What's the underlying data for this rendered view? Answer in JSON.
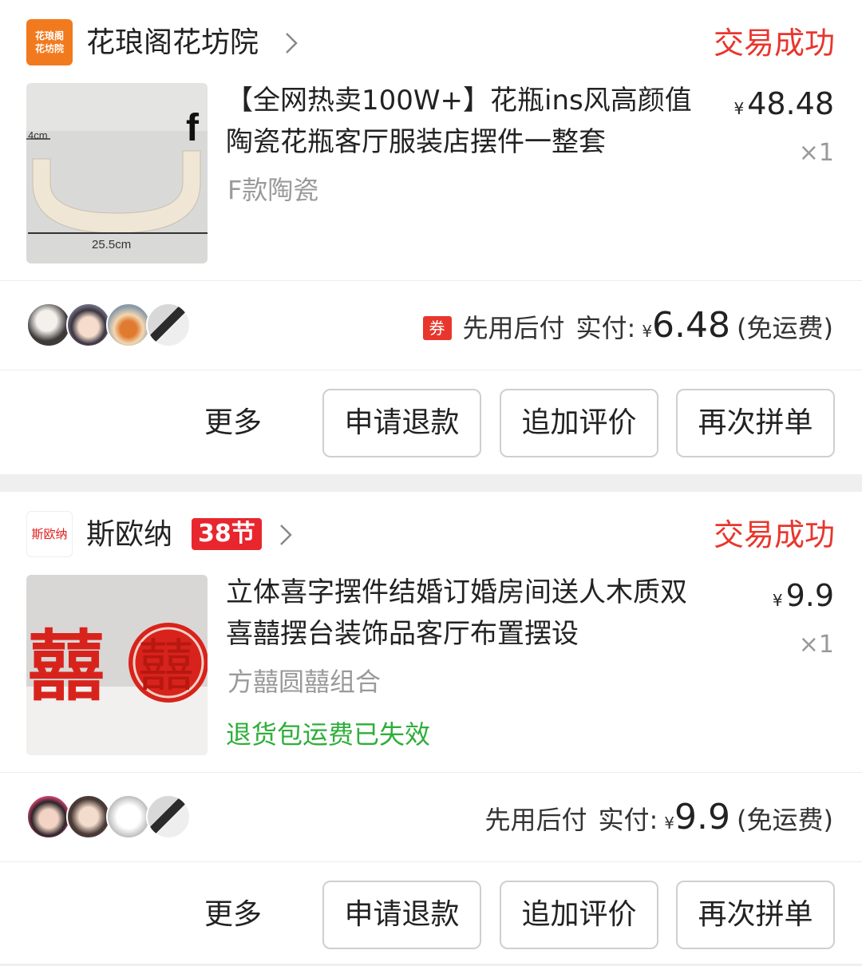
{
  "orders": [
    {
      "shop": {
        "logo_text": [
          "花琅阁",
          "花坊院"
        ],
        "name": "花琅阁花坊院",
        "status": "交易成功"
      },
      "product": {
        "title": "【全网热卖100W+】花瓶ins风高颜值陶瓷花瓶客厅服装店摆件一整套",
        "sku": "F款陶瓷",
        "price_symbol": "¥",
        "price": "48.48",
        "qty": "×1",
        "image_labels": {
          "height": "4cm",
          "width": "25.5cm",
          "corner": "f"
        }
      },
      "payment": {
        "coupon_icon": "券",
        "method": "先用后付",
        "paid_label": "实付:",
        "paid_symbol": "¥",
        "paid_amount": "6.48",
        "shipping": "(免运费)"
      },
      "actions": {
        "more": "更多",
        "refund": "申请退款",
        "review": "追加评价",
        "reorder": "再次拼单"
      }
    },
    {
      "shop": {
        "logo_text": [
          "斯欧纳"
        ],
        "name": "斯欧纳",
        "badge": "38节",
        "status": "交易成功"
      },
      "product": {
        "title": "立体喜字摆件结婚订婚房间送人木质双喜囍摆台装饰品客厅布置摆设",
        "sku": "方囍圆囍组合",
        "return_note": "退货包运费已失效",
        "price_symbol": "¥",
        "price": "9.9",
        "qty": "×1",
        "image_glyph": "囍"
      },
      "payment": {
        "method": "先用后付",
        "paid_label": "实付:",
        "paid_symbol": "¥",
        "paid_amount": "9.9",
        "shipping": "(免运费)"
      },
      "actions": {
        "more": "更多",
        "refund": "申请退款",
        "review": "追加评价",
        "reorder": "再次拼单"
      }
    }
  ],
  "colors": {
    "status": "#e8362d",
    "return_note": "#2fae3a",
    "brand_logo": "#f27a1e",
    "badge": "#e8262e"
  }
}
